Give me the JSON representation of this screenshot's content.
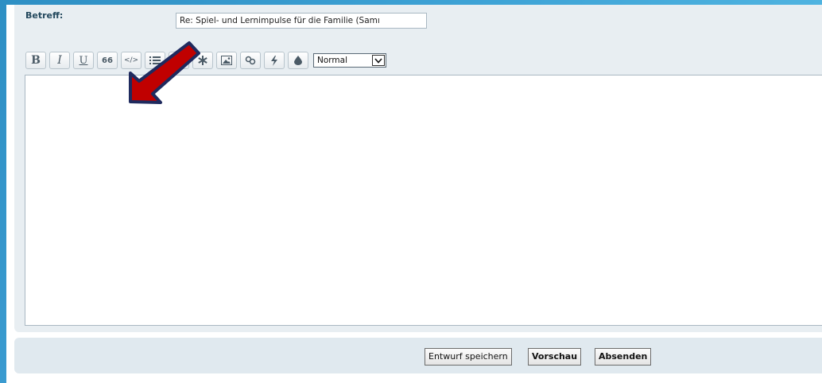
{
  "subject": {
    "label": "Betreff:",
    "value": "Re: Spiel- und Lernimpulse für die Familie (Samı"
  },
  "toolbar": {
    "bold_label": "B",
    "italic_label": "I",
    "underline_label": "U",
    "quote_label": "66",
    "code_label": "</>",
    "size_select_value": "Normal"
  },
  "editor": {
    "content": ""
  },
  "submit": {
    "draft_label": "Entwurf speichern",
    "preview_label": "Vorschau",
    "send_label": "Absenden"
  },
  "colors": {
    "frame": "#2e8fc4",
    "panel": "#e8eef2",
    "arrow_fill": "#c00000",
    "arrow_outline": "#1f2a5e"
  }
}
